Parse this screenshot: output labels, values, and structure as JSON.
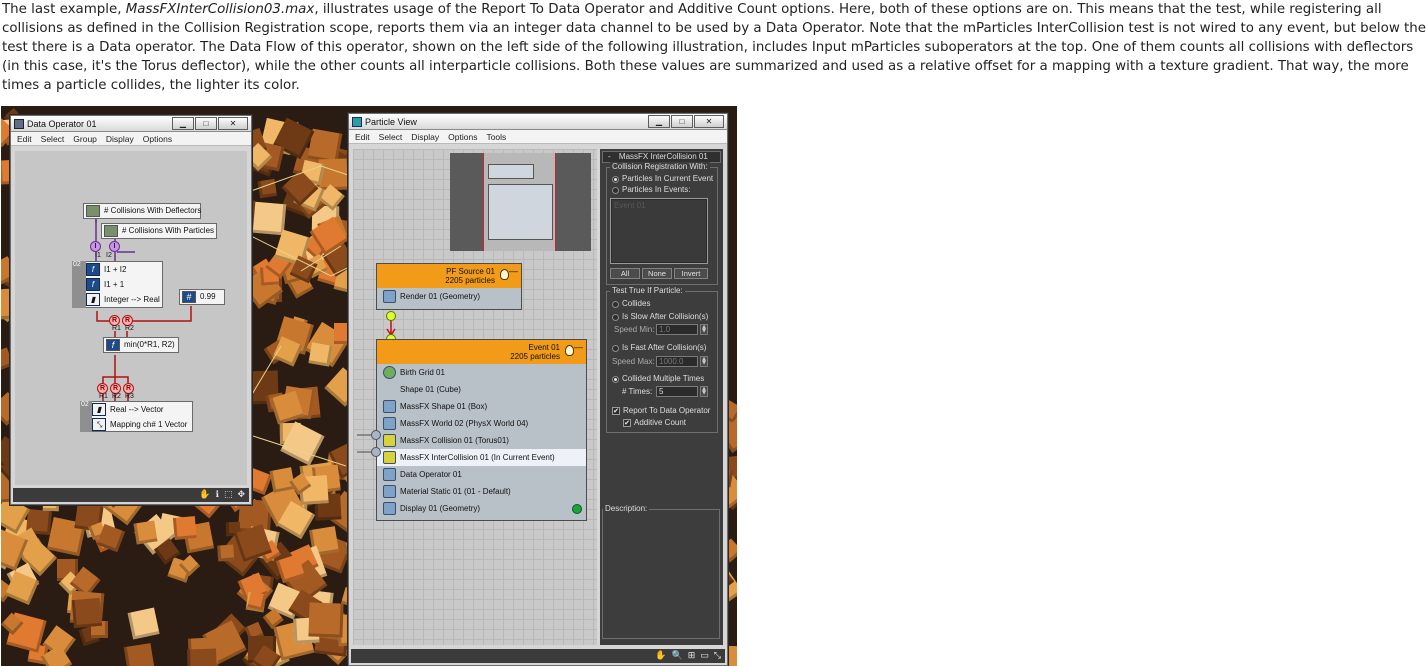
{
  "paragraph": {
    "intro": "The last example, ",
    "filename": "MassFXInterCollision03.max",
    "body": ", illustrates usage of the Report To Data Operator and Additive Count options. Here, both of these options are on. This means that the test, while registering all collisions as defined in the Collision Registration scope, reports them via an integer data channel to be used by a Data Operator. Note that the mParticles InterCollision test is not wired to any event, but below the test there is a Data operator. The Data Flow of this operator, shown on the left side of the following illustration, includes Input mParticles suboperators at the top. One of them counts all collisions with deflectors (in this case, it's the Torus deflector), while the other counts all interparticle collisions. Both these values are summarized and used as a relative offset for a mapping with a texture gradient. That way, the more times a particle collides, the lighter its color."
  },
  "colors": {
    "event_header": "#f29b18",
    "selected_row": "#eef2f8",
    "wire_purple": "#6a2f8d",
    "wire_red": "#b31010",
    "panel_bg": "#3d3d3d"
  },
  "data_operator_window": {
    "title": "Data Operator 01",
    "buttons": {
      "minimize": "▁",
      "maximize": "□",
      "close": "✕"
    },
    "menu": [
      "Edit",
      "Select",
      "Group",
      "Display",
      "Options"
    ],
    "nodes": {
      "collisions_deflectors": "# Collisions With Deflectors",
      "collisions_particles": "# Collisions With Particles",
      "group_badge": "02",
      "group_rows": [
        "I1 + I2",
        "I1 + 1",
        "Integer --> Real"
      ],
      "scalar_value": "0.99",
      "min_function": "min(0*R1, R2)",
      "group2_badge": "02",
      "group2_rows": [
        "Real --> Vector",
        "Mapping ch# 1 Vector"
      ]
    },
    "ports": {
      "p_in": [
        "I",
        "I"
      ],
      "p_out": [
        "I1",
        "I2"
      ],
      "r_mid": [
        "R",
        "R"
      ],
      "r_mid_out": [
        "R1",
        "R2"
      ],
      "r_low": [
        "R",
        "R",
        "R"
      ],
      "r_low_out": [
        "R1",
        "R2",
        "R3"
      ]
    },
    "status_icons": [
      "✋",
      "ℹ",
      "⬚",
      "✥"
    ]
  },
  "particle_view_window": {
    "title": "Particle View",
    "buttons": {
      "minimize": "▁",
      "maximize": "□",
      "close": "✕"
    },
    "menu": [
      "Edit",
      "Select",
      "Display",
      "Options",
      "Tools"
    ],
    "pf_source": {
      "name": "PF Source 01",
      "count": "2205 particles",
      "rows": [
        "Render 01 (Geometry)"
      ]
    },
    "event": {
      "name": "Event 01",
      "count": "2205 particles",
      "rows": [
        "Birth Grid 01",
        "Shape 01 (Cube)",
        "MassFX Shape 01 (Box)",
        "MassFX World 02 (PhysX World 04)",
        "MassFX Collision 01 (Torus01)",
        "MassFX InterCollision 01 (In Current Event)",
        "Data Operator 01",
        "Material Static 01 (01 - Default)",
        "Display 01 (Geometry)"
      ],
      "selected_index": 5
    },
    "rollout": {
      "title": "MassFX InterCollision 01",
      "collapse": "-",
      "collision_group": "Collision Registration With:",
      "reg_options": [
        "Particles In Current Event",
        "Particles In Events:"
      ],
      "list_item": "Event 01",
      "list_buttons": [
        "All",
        "None",
        "Invert"
      ],
      "test_group": "Test True If Particle:",
      "test_options": [
        "Collides",
        "Is Slow After Collision(s)",
        "Is Fast After Collision(s)",
        "Collided Multiple Times"
      ],
      "speed_min_label": "Speed Min:",
      "speed_min": "1.0",
      "speed_max_label": "Speed Max:",
      "speed_max": "1000.0",
      "times_label": "# Times:",
      "times": "5",
      "report_label": "Report To Data Operator",
      "additive_label": "Additive Count",
      "description_label": "Description:"
    },
    "status_icons": [
      "✋",
      "🔍",
      "⊞",
      "▭",
      "⤡"
    ]
  }
}
